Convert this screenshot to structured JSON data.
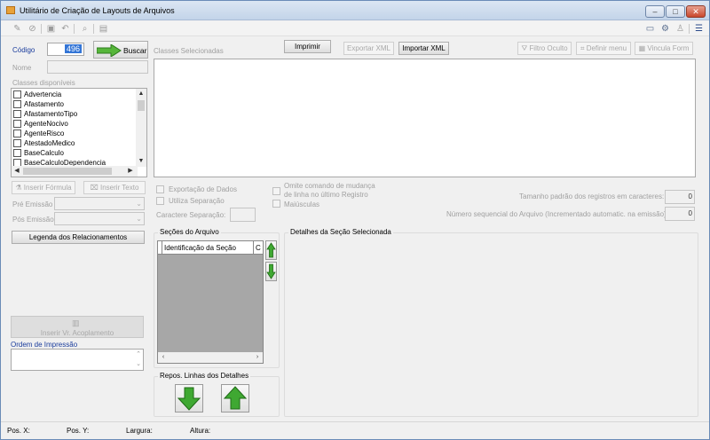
{
  "window": {
    "title": "Utilitário de Criação de Layouts de Arquivos",
    "minimize_label": "–",
    "maximize_label": "□",
    "close_label": "✕"
  },
  "toolbar": {
    "icons": [
      "new-icon",
      "cancel-icon",
      "save-icon",
      "undo-icon",
      "find-icon",
      "print-preview-icon"
    ],
    "right_icons": [
      "window-icon",
      "settings-icon",
      "user-icon",
      "menu-icon"
    ]
  },
  "top": {
    "codigo_label": "Código",
    "codigo_value": "496",
    "buscar_label": "Buscar",
    "classes_selecionadas_label": "Classes Selecionadas",
    "nome_label": "Nome",
    "classes_disponiveis_label": "Classes disponíveis",
    "imprimir_label": "Imprimir",
    "exportar_xml_label": "Exportar XML",
    "importar_xml_label": "Importar XML",
    "filtro_oculto_label": "Filtro Oculto",
    "definir_menu_label": "Definir menu",
    "vincula_form_label": "Vincula Form"
  },
  "classes": [
    "Advertencia",
    "Afastamento",
    "AfastamentoTipo",
    "AgenteNocivo",
    "AgenteRisco",
    "AtestadoMedico",
    "BaseCalculo",
    "BaseCalculoDependencia"
  ],
  "left": {
    "inserir_formula_label": "Inserir Fórmula",
    "inserir_texto_label": "Inserir Texto",
    "pre_emissao_label": "Pré Emissão",
    "pos_emissao_label": "Pós Emissão",
    "legenda_label": "Legenda dos Relacionamentos",
    "inserir_acoplamento_label": "Inserir Vr. Acoplamento",
    "ordem_impressao_label": "Ordem de Impressão"
  },
  "options": {
    "exportacao_dados_label": "Exportação de Dados",
    "utiliza_separacao_label": "Utiliza Separação",
    "caractere_separacao_label": "Caractere Separação:",
    "omite_comando_line1": "Omite comando de mudança",
    "omite_comando_line2": "de linha no último Registro",
    "maiusculas_label": "Maiúsculas",
    "tamanho_padrao_label": "Tamanho padrão dos registros em caracteres:",
    "tamanho_padrao_value": "0",
    "numero_sequencial_label": "Número sequencial do Arquivo (Incrementado automatic. na emissão):",
    "numero_sequencial_value": "0"
  },
  "secoes": {
    "title": "Seções do Arquivo",
    "col_identificacao": "Identificação da Seção",
    "col_c": "C",
    "repos_title": "Repos. Linhas dos Detalhes",
    "detalhes_title": "Detalhes da Seção Selecionada"
  },
  "status": {
    "pos_x": "Pos. X:",
    "pos_y": "Pos. Y:",
    "largura": "Largura:",
    "altura": "Altura:"
  },
  "colors": {
    "accent_green": "#3fa832",
    "title_bar": "#c9d6e6",
    "grid_gray": "#a7a7a7"
  }
}
